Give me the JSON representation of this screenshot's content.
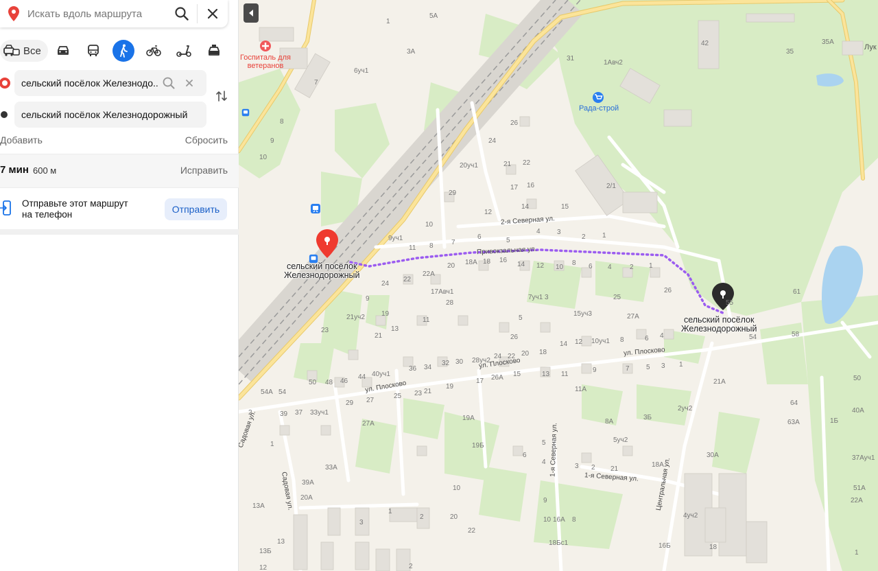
{
  "search": {
    "placeholder": "Искать вдоль маршрута"
  },
  "modes": {
    "all_label": "Все"
  },
  "route": {
    "from_value": "сельский посёлок Железнодо...",
    "to_value": "сельский посёлок Железнодорожный",
    "add_label": "Добавить",
    "reset_label": "Сбросить",
    "time": "7 мин",
    "distance": "600 м",
    "fix_label": "Исправить"
  },
  "send": {
    "text_line1": "Отправьте этот маршрут",
    "text_line2": "на телефон",
    "button_label": "Отправить"
  },
  "map": {
    "start_label_line1": "сельский посёлок",
    "start_label_line2": "Железнодорожный",
    "end_label_line1": "сельский посёлок",
    "end_label_line2": "Железнодорожный",
    "hospital_line1": "Госпиталь для",
    "hospital_line2": "ветеранов",
    "store": "Рада-строй",
    "luk": "Лук",
    "streets": {
      "north2": "2-я Северная ул.",
      "vokzal": "Привокзальная ул.",
      "ploskovo1": "ул. Плосково",
      "ploskovo2": "ул. Плосково",
      "north1_v": "1-я Северная ул.",
      "north1_h": "1-я Северная ул.",
      "central": "Центральная ул.",
      "sadovaya": "Садовая ул.",
      "sadovaya2": "Садовая ул."
    },
    "numbers": [
      "1",
      "5А",
      "3А",
      "6уч1",
      "7",
      "8",
      "9",
      "10",
      "31",
      "1Авч2",
      "42",
      "35",
      "35А",
      "26",
      "24",
      "20уч1",
      "21",
      "22",
      "29",
      "17",
      "16",
      "12",
      "14",
      "15",
      "2/1",
      "10",
      "9уч1",
      "11",
      "8",
      "7",
      "6",
      "5",
      "4",
      "3",
      "2",
      "1",
      "20",
      "18А",
      "18",
      "16",
      "14",
      "12",
      "10",
      "8",
      "6",
      "4",
      "2",
      "1",
      "26",
      "24",
      "22",
      "22А",
      "17Авч1",
      "28",
      "9",
      "7уч1",
      "3",
      "25",
      "21уч2",
      "19",
      "11",
      "5",
      "15уч3",
      "27А",
      "23",
      "21",
      "13",
      "26",
      "24",
      "22",
      "20",
      "18",
      "14",
      "12",
      "10уч1",
      "8",
      "6",
      "4",
      "55",
      "61",
      "54",
      "58",
      "36",
      "34",
      "32",
      "30",
      "28уч2",
      "40уч1",
      "44",
      "46",
      "48",
      "50",
      "54А",
      "54",
      "17",
      "26А",
      "15",
      "13",
      "11",
      "9",
      "7",
      "5",
      "3",
      "1",
      "21А",
      "50",
      "39",
      "37",
      "33уч1",
      "29",
      "27",
      "25",
      "23",
      "21",
      "19",
      "11А",
      "2уч2",
      "64",
      "63А",
      "40А",
      "1Б",
      "27А",
      "19А",
      "8А",
      "3Б",
      "5уч2",
      "2",
      "1",
      "33А",
      "19Б",
      "6",
      "5",
      "4",
      "3",
      "2",
      "21",
      "18А",
      "30А",
      "37Ауч1",
      "39А",
      "20А",
      "10",
      "9",
      "10",
      "8",
      "16А",
      "4уч2",
      "51А",
      "22А",
      "22",
      "20",
      "2",
      "1",
      "3",
      "13",
      "13А",
      "13Б",
      "12",
      "18Бс1",
      "16Б",
      "18",
      "2",
      "1"
    ]
  }
}
